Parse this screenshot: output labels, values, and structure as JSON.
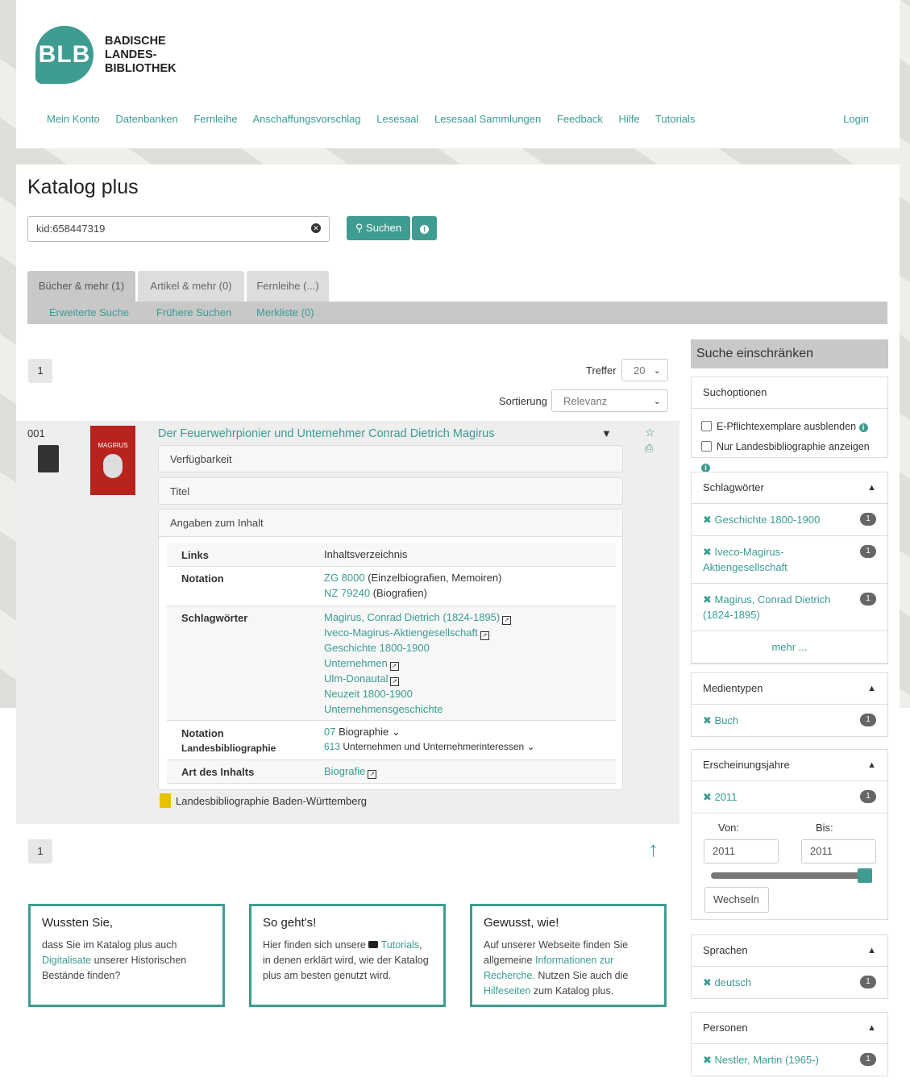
{
  "header": {
    "logo_abbr": "BLB",
    "logo_line1": "BADISCHE",
    "logo_line2": "LANDES-",
    "logo_line3": "BIBLIOTHEK",
    "nav": [
      "Mein Konto",
      "Datenbanken",
      "Fernleihe",
      "Anschaffungsvorschlag",
      "Lesesaal",
      "Lesesaal Sammlungen",
      "Feedback",
      "Hilfe",
      "Tutorials"
    ],
    "login": "Login"
  },
  "page_title": "Katalog plus",
  "search": {
    "value": "kid:658447319",
    "button": "Suchen"
  },
  "tabs": [
    "Bücher & mehr (1)",
    "Artikel & mehr (0)",
    "Fernleihe (...)"
  ],
  "subnav": [
    "Erweiterte Suche",
    "Frühere Suchen",
    "Merkliste (0)"
  ],
  "pagination": {
    "current": "1"
  },
  "treffer": {
    "label": "Treffer",
    "value": "20"
  },
  "sort": {
    "label": "Sortierung",
    "value": "Relevanz"
  },
  "result": {
    "number": "001",
    "cover_text": "MAGIRUS",
    "title": "Der Feuerwehrpionier und Unternehmer Conrad Dietrich Magirus",
    "panels": [
      "Verfügbarkeit",
      "Titel",
      "Angaben zum Inhalt"
    ],
    "details": {
      "links_key": "Links",
      "links_val": "Inhaltsverzeichnis",
      "notation_key": "Notation",
      "notation_1_link": "ZG 8000",
      "notation_1_text": "(Einzelbiografien, Memoiren)",
      "notation_2_link": "NZ 79240",
      "notation_2_text": "(Biografien)",
      "schlag_key": "Schlagwörter",
      "schlag": [
        "Magirus, Conrad Dietrich (1824-1895)",
        "Iveco-Magirus-Aktiengesellschaft",
        "Geschichte 1800-1900",
        "Unternehmen",
        "Ulm-Donautal",
        "Neuzeit 1800-1900",
        "Unternehmensgeschichte"
      ],
      "lb_key_1": "Notation",
      "lb_key_2": "Landesbibliographie",
      "lb_1_link": "07",
      "lb_1_text": "Biographie",
      "lb_2_link": "613",
      "lb_2_text": "Unternehmen und Unternehmerinteressen",
      "art_key": "Art des Inhalts",
      "art_val": "Biografie"
    },
    "landesbib": "Landesbibliographie Baden-Württemberg"
  },
  "sidebar": {
    "title": "Suche einschränken",
    "suchoptionen": "Suchoptionen",
    "opt1": "E-Pflichtexemplare ausblenden",
    "opt2": "Nur Landesbibliographie anzeigen",
    "schlagwoerter": "Schlagwörter",
    "sw_items": [
      "Geschichte 1800-1900",
      "Iveco-Magirus-Aktiengesellschaft",
      "Magirus, Conrad Dietrich (1824-1895)"
    ],
    "mehr": "mehr ...",
    "medientypen": "Medientypen",
    "mt_item": "Buch",
    "erscheinungsjahre": "Erscheinungsjahre",
    "ej_item": "2011",
    "von": "Von:",
    "bis": "Bis:",
    "von_val": "2011",
    "bis_val": "2011",
    "wechseln": "Wechseln",
    "sprachen": "Sprachen",
    "sp_item": "deutsch",
    "personen": "Personen",
    "pe_item": "Nestler, Martin (1965-)",
    "count": "1"
  },
  "tips": {
    "t1_title": "Wussten Sie,",
    "t1_a": "dass Sie im Katalog plus auch",
    "t1_link": "Digitalisate",
    "t1_b": "unserer Historischen Bestände finden?",
    "t2_title": "So geht's!",
    "t2_a": "Hier finden sich unsere",
    "t2_link": "Tutorials",
    "t2_b": ", in denen erklärt wird, wie der Katalog plus am besten genutzt wird.",
    "t3_title": "Gewusst, wie!",
    "t3_a": "Auf unserer Webseite finden Sie allgemeine",
    "t3_link1": "Informationen zur Recherche.",
    "t3_b": "Nutzen Sie auch die",
    "t3_link2": "Hilfeseiten",
    "t3_c": "zum Katalog plus."
  }
}
